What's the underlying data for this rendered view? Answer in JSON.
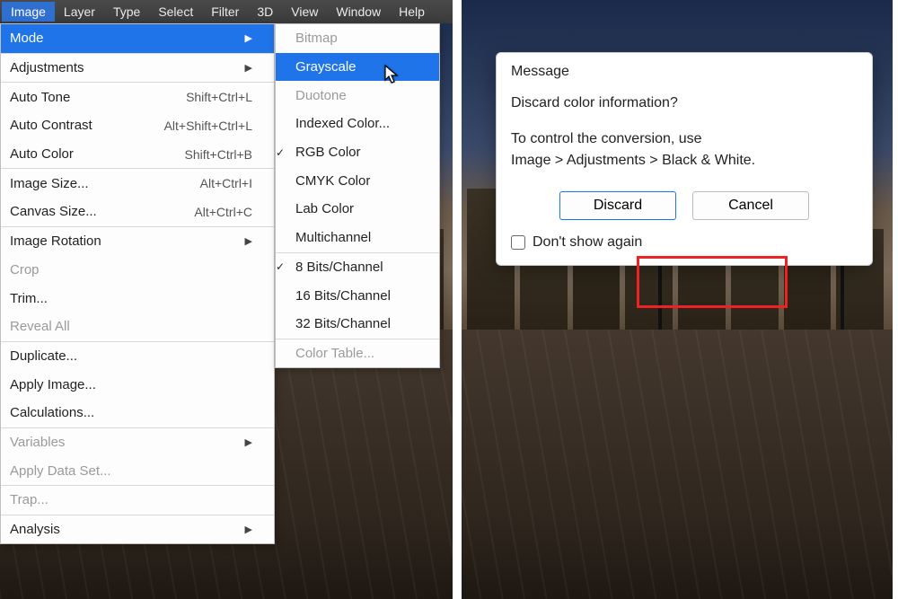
{
  "menubar": {
    "items": [
      "Image",
      "Layer",
      "Type",
      "Select",
      "Filter",
      "3D",
      "View",
      "Window",
      "Help"
    ],
    "active_index": 0
  },
  "image_menu": {
    "groups": [
      [
        {
          "label": "Mode",
          "has_submenu": true,
          "selected": true
        }
      ],
      [
        {
          "label": "Adjustments",
          "has_submenu": true
        }
      ],
      [
        {
          "label": "Auto Tone",
          "shortcut": "Shift+Ctrl+L"
        },
        {
          "label": "Auto Contrast",
          "shortcut": "Alt+Shift+Ctrl+L"
        },
        {
          "label": "Auto Color",
          "shortcut": "Shift+Ctrl+B"
        }
      ],
      [
        {
          "label": "Image Size...",
          "shortcut": "Alt+Ctrl+I"
        },
        {
          "label": "Canvas Size...",
          "shortcut": "Alt+Ctrl+C"
        }
      ],
      [
        {
          "label": "Image Rotation",
          "has_submenu": true
        },
        {
          "label": "Crop",
          "disabled": true
        },
        {
          "label": "Trim..."
        },
        {
          "label": "Reveal All",
          "disabled": true
        }
      ],
      [
        {
          "label": "Duplicate..."
        },
        {
          "label": "Apply Image..."
        },
        {
          "label": "Calculations..."
        }
      ],
      [
        {
          "label": "Variables",
          "has_submenu": true,
          "disabled": true
        },
        {
          "label": "Apply Data Set...",
          "disabled": true
        }
      ],
      [
        {
          "label": "Trap...",
          "disabled": true
        }
      ],
      [
        {
          "label": "Analysis",
          "has_submenu": true
        }
      ]
    ]
  },
  "mode_menu": {
    "groups": [
      [
        {
          "label": "Bitmap",
          "disabled": true
        },
        {
          "label": "Grayscale",
          "selected": true
        },
        {
          "label": "Duotone",
          "disabled": true
        },
        {
          "label": "Indexed Color..."
        },
        {
          "label": "RGB Color",
          "checked": true
        },
        {
          "label": "CMYK Color"
        },
        {
          "label": "Lab Color"
        },
        {
          "label": "Multichannel"
        }
      ],
      [
        {
          "label": "8 Bits/Channel",
          "checked": true
        },
        {
          "label": "16 Bits/Channel"
        },
        {
          "label": "32 Bits/Channel"
        }
      ],
      [
        {
          "label": "Color Table...",
          "disabled": true
        }
      ]
    ]
  },
  "dialog": {
    "title": "Message",
    "question": "Discard color information?",
    "hint_line1": "To control the conversion, use",
    "hint_line2": "Image > Adjustments > Black & White.",
    "discard": "Discard",
    "cancel": "Cancel",
    "dont_show": "Don't show again"
  }
}
